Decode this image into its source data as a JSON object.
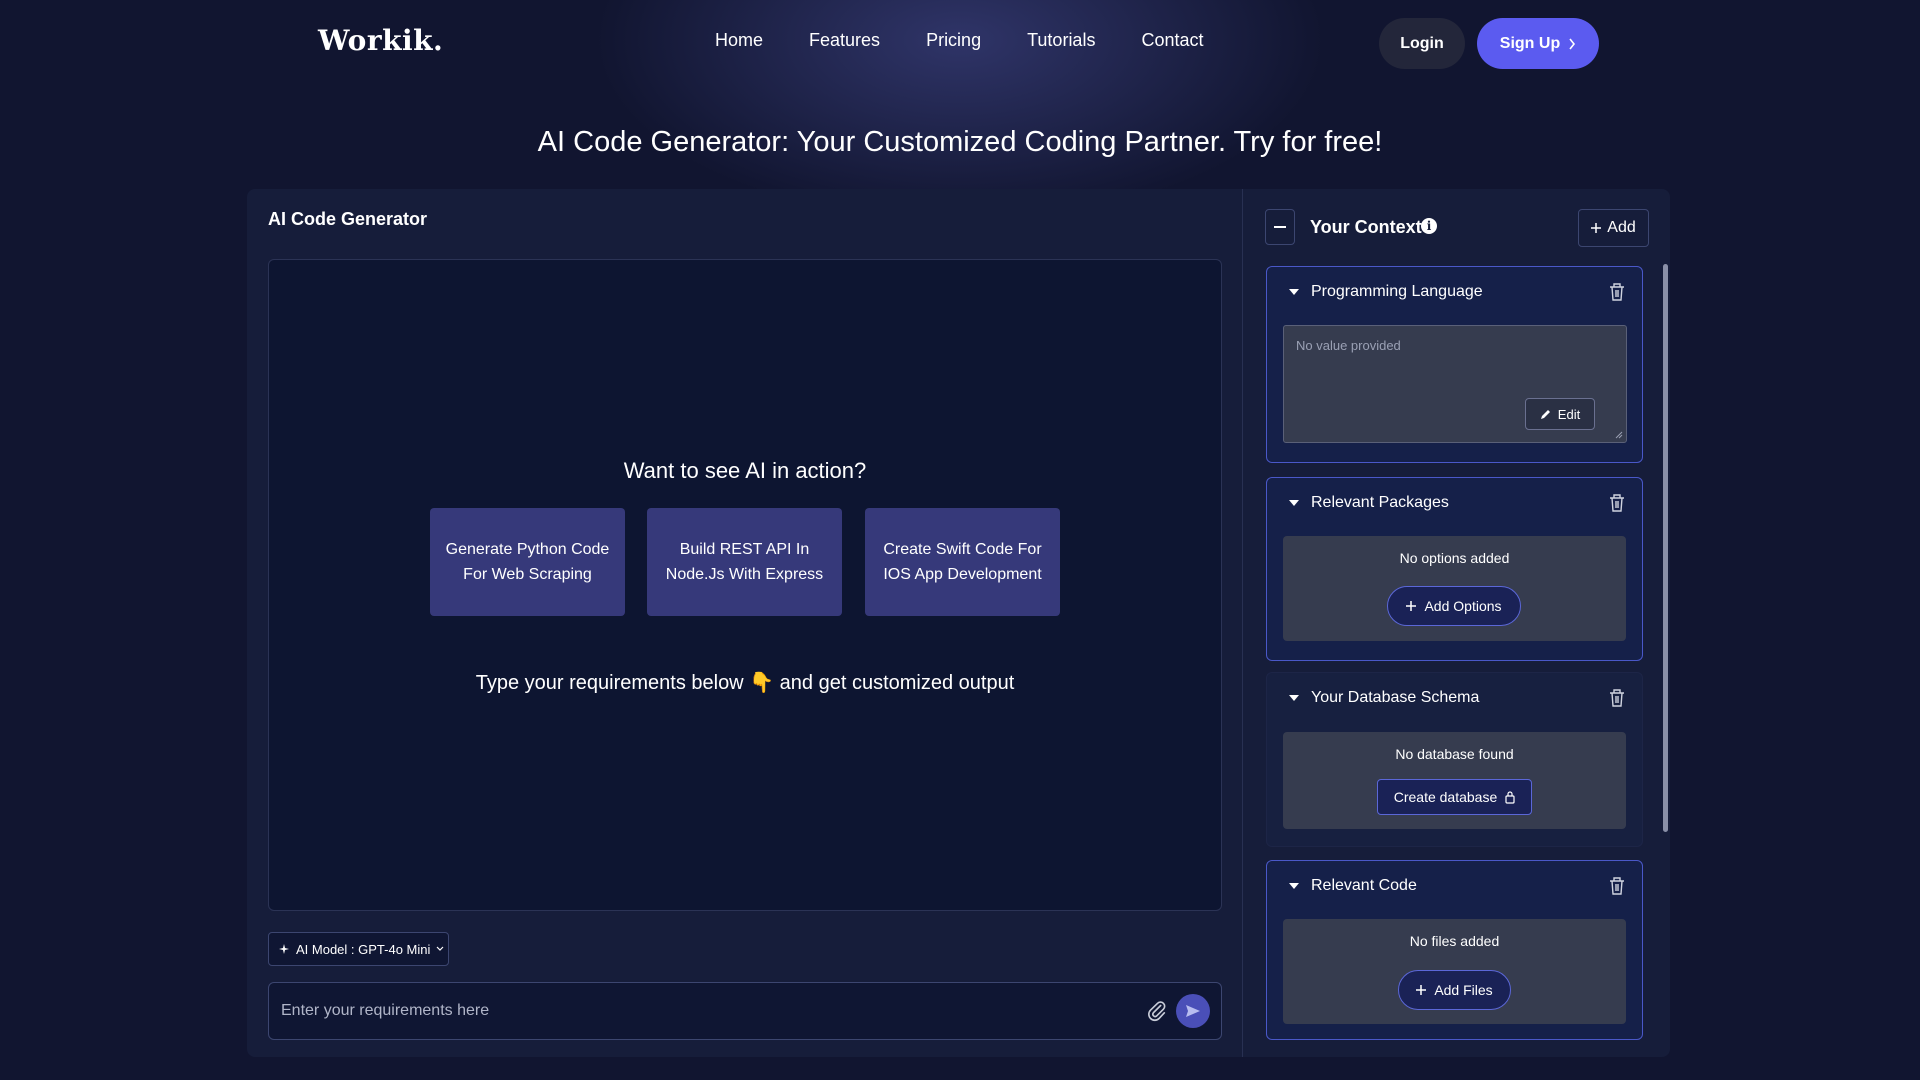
{
  "nav": {
    "logo": "Workik.",
    "links": [
      "Home",
      "Features",
      "Pricing",
      "Tutorials",
      "Contact"
    ],
    "login": "Login",
    "signup": "Sign Up"
  },
  "hero": {
    "title": "AI Code Generator: Your Customized Coding Partner. Try for free!"
  },
  "generator": {
    "title": "AI Code Generator",
    "prompt_heading": "Want to see AI in action?",
    "samples": [
      "Generate Python Code For Web Scraping",
      "Build REST API In Node.Js With Express",
      "Create Swift Code For IOS App Development"
    ],
    "type_hint_before": "Type your requirements below",
    "type_hint_emoji": "👇",
    "type_hint_after": "and get customized output",
    "model_label": "AI Model : GPT-4o Mini",
    "input_placeholder": "Enter your requirements here"
  },
  "context": {
    "title": "Your Context",
    "add": "Add",
    "sections": {
      "language": {
        "title": "Programming Language",
        "placeholder": "No value provided",
        "edit": "Edit"
      },
      "packages": {
        "title": "Relevant Packages",
        "empty": "No options added",
        "button": "Add Options"
      },
      "database": {
        "title": "Your Database Schema",
        "empty": "No database found",
        "button": "Create database"
      },
      "code": {
        "title": "Relevant Code",
        "empty": "No files added",
        "button": "Add Files"
      }
    }
  },
  "colors": {
    "background": "#111530",
    "accent": "#5b5bf0",
    "sample_card": "#36397a",
    "section_border": "#4a58c8"
  }
}
